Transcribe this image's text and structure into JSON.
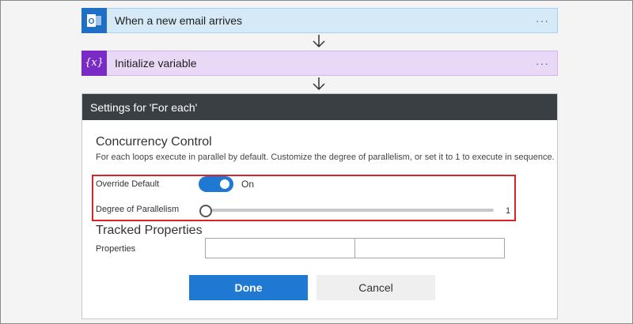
{
  "steps": [
    {
      "title": "When a new email arrives",
      "more": "···",
      "icon": "outlook-icon"
    },
    {
      "title": "Initialize variable",
      "more": "···",
      "icon": "variable-icon",
      "icon_text": "{x}"
    }
  ],
  "panel": {
    "header": "Settings for 'For each'",
    "concurrency": {
      "title": "Concurrency Control",
      "description": "For each loops execute in parallel by default. Customize the degree of parallelism, or set it to 1 to execute in sequence.",
      "override_label": "Override Default",
      "toggle_state": "On",
      "parallelism_label": "Degree of Parallelism",
      "parallelism_value": "1"
    },
    "tracked": {
      "title": "Tracked Properties",
      "properties_label": "Properties",
      "key_value": "",
      "value_value": ""
    },
    "done_label": "Done",
    "cancel_label": "Cancel"
  },
  "colors": {
    "accent": "#1f78d1",
    "highlight": "#d8232a",
    "header_bg": "#3a3f44"
  }
}
